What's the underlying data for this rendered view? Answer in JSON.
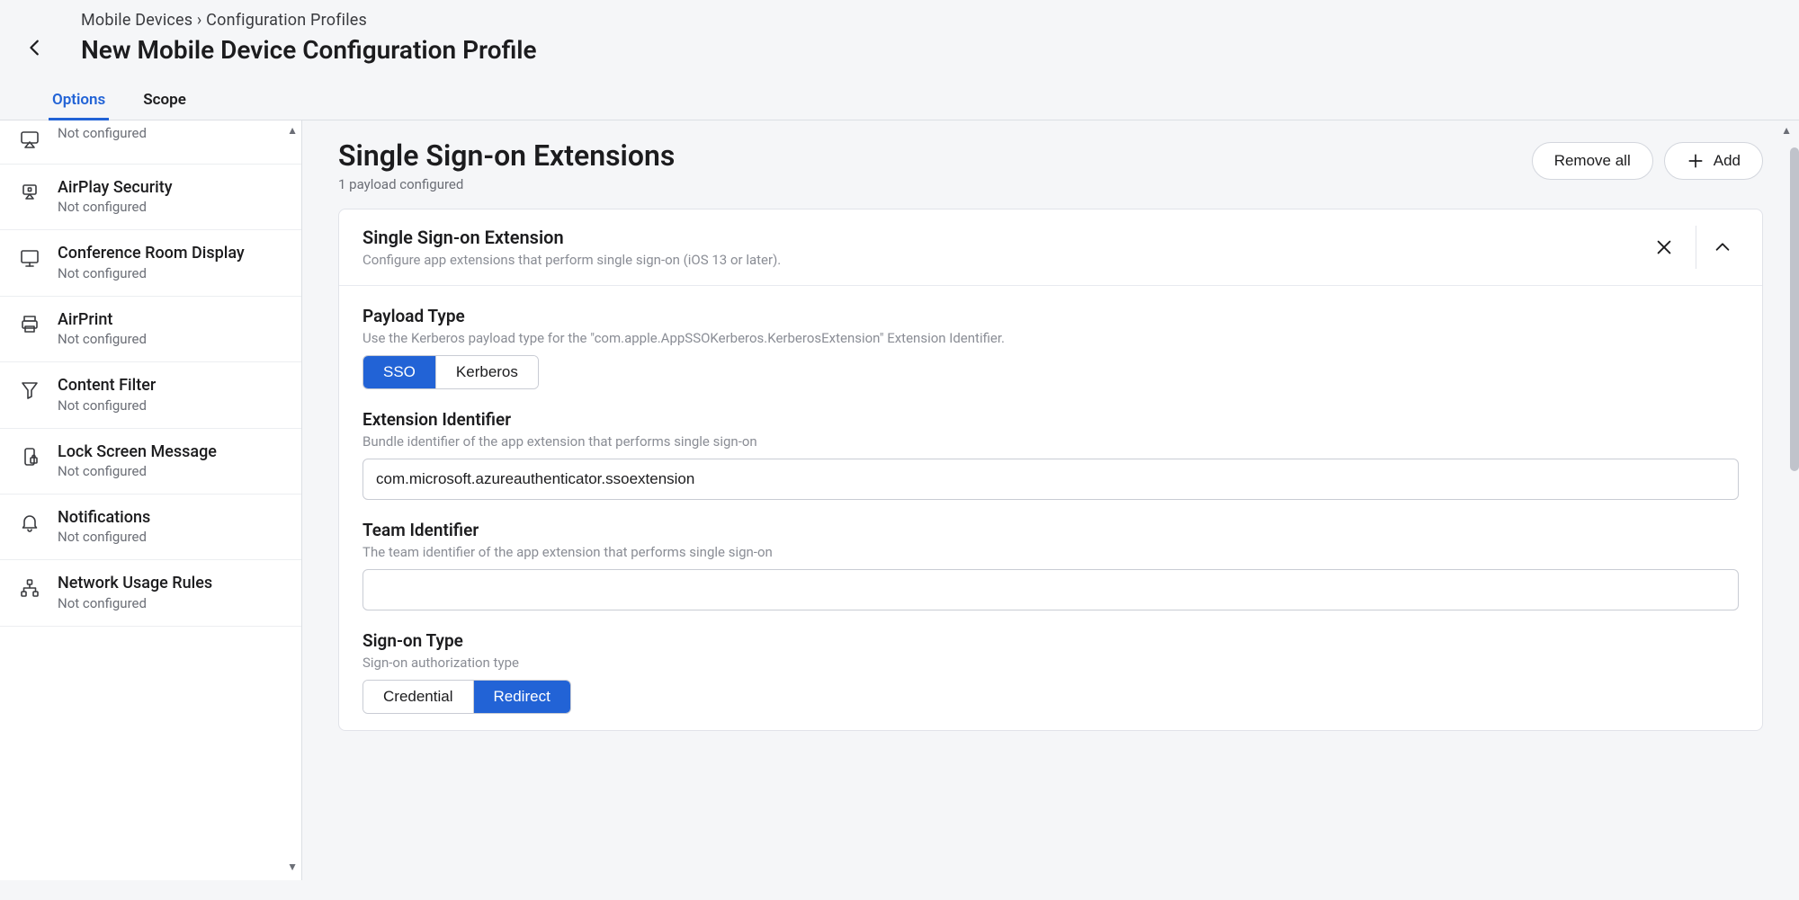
{
  "breadcrumbs": "Mobile Devices    ›   Configuration Profiles",
  "page_title": "New Mobile Device Configuration Profile",
  "tabs": {
    "options": "Options",
    "scope": "Scope"
  },
  "sidebar": {
    "items": [
      {
        "title": "...",
        "sub": "Not configured"
      },
      {
        "title": "AirPlay Security",
        "sub": "Not configured"
      },
      {
        "title": "Conference Room Display",
        "sub": "Not configured"
      },
      {
        "title": "AirPrint",
        "sub": "Not configured"
      },
      {
        "title": "Content Filter",
        "sub": "Not configured"
      },
      {
        "title": "Lock Screen Message",
        "sub": "Not configured"
      },
      {
        "title": "Notifications",
        "sub": "Not configured"
      },
      {
        "title": "Network Usage Rules",
        "sub": "Not configured"
      }
    ]
  },
  "main": {
    "title": "Single Sign-on Extensions",
    "subtitle": "1 payload configured",
    "remove_all": "Remove all",
    "add": "Add"
  },
  "card": {
    "title": "Single Sign-on Extension",
    "desc": "Configure app extensions that perform single sign-on (iOS 13 or later)."
  },
  "fields": {
    "payload_type": {
      "label": "Payload Type",
      "help": "Use the Kerberos payload type for the \"com.apple.AppSSOKerberos.KerberosExtension\" Extension Identifier.",
      "opt_sso": "SSO",
      "opt_kerberos": "Kerberos"
    },
    "ext_id": {
      "label": "Extension Identifier",
      "help": "Bundle identifier of the app extension that performs single sign-on",
      "value": "com.microsoft.azureauthenticator.ssoextension"
    },
    "team_id": {
      "label": "Team Identifier",
      "help": "The team identifier of the app extension that performs single sign-on",
      "value": ""
    },
    "signon_type": {
      "label": "Sign-on Type",
      "help": "Sign-on authorization type",
      "opt_credential": "Credential",
      "opt_redirect": "Redirect"
    }
  }
}
